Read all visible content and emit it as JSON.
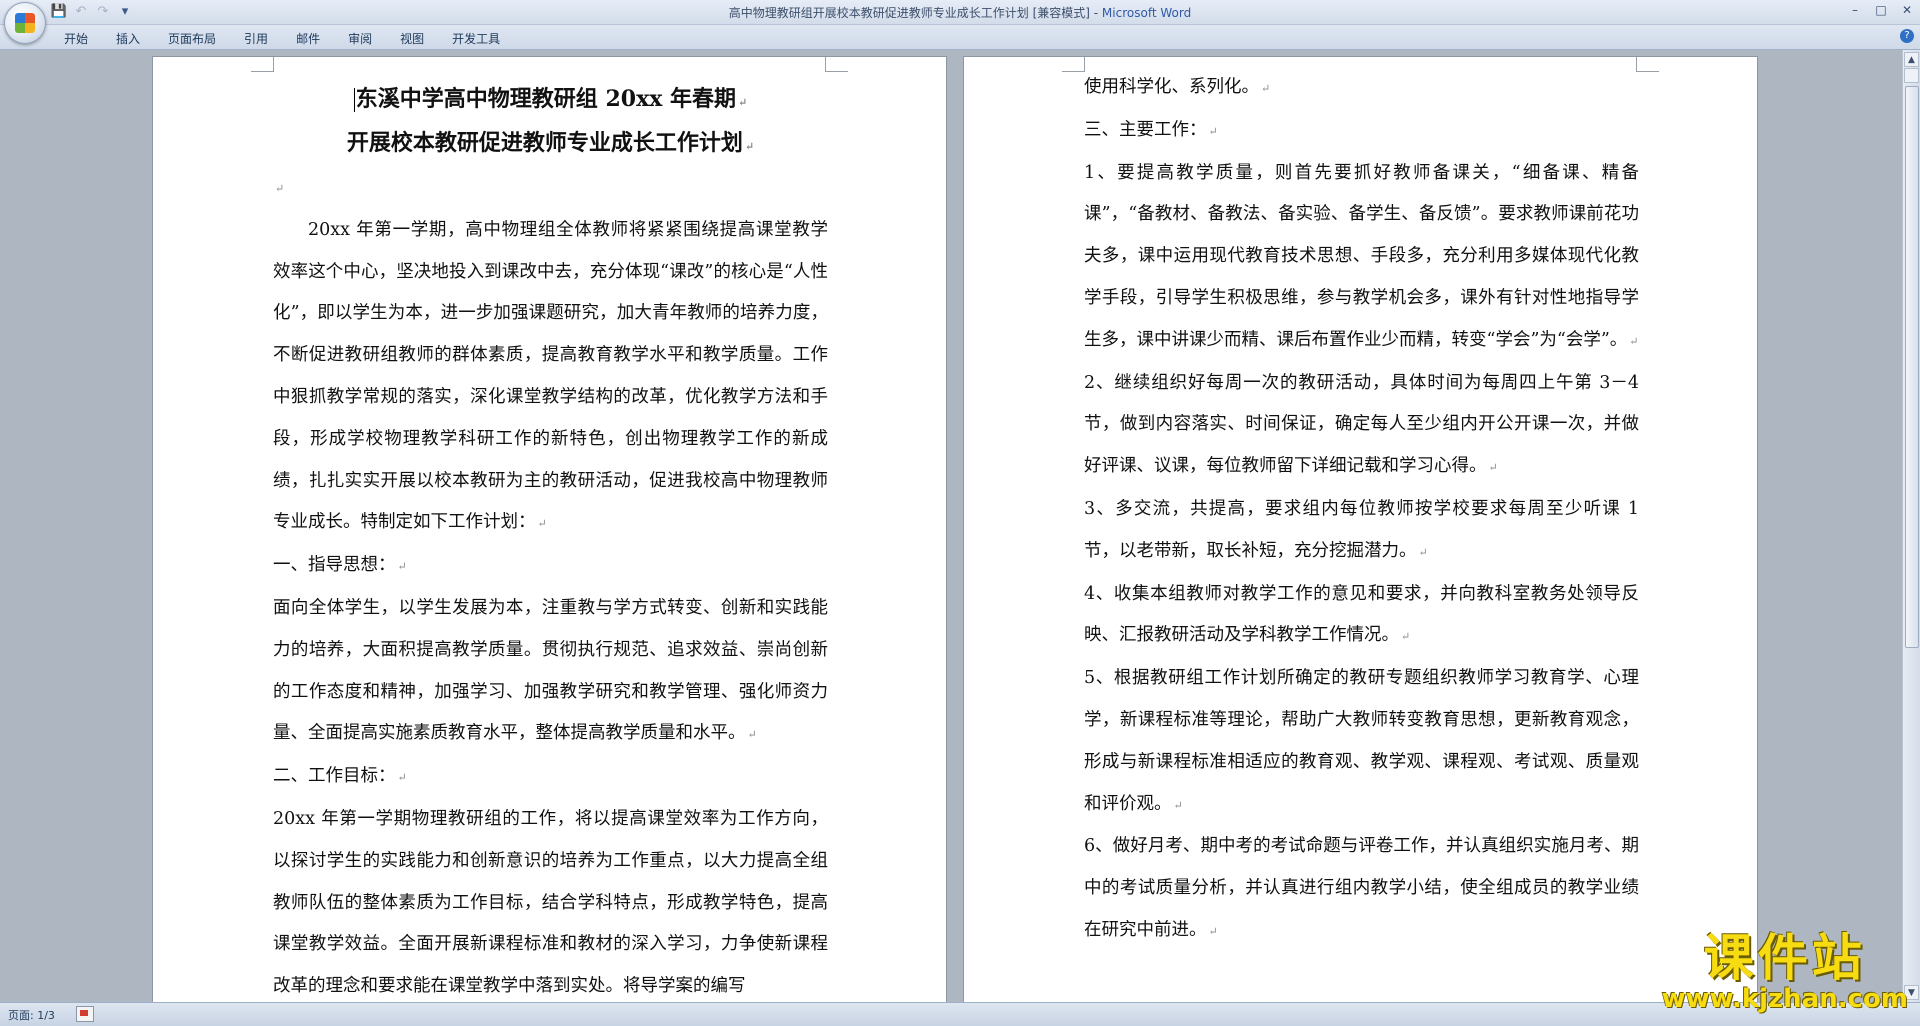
{
  "window": {
    "title": "高中物理教研组开展校本教研促进教师专业成长工作计划 [兼容模式] - ",
    "app_name": "Microsoft Word",
    "minimize": "–",
    "maximize": "□",
    "close": "✕"
  },
  "quick_access": {
    "save": "💾",
    "undo": "↶",
    "redo": "↷",
    "more": "▾"
  },
  "ribbon_tabs": [
    "开始",
    "插入",
    "页面布局",
    "引用",
    "邮件",
    "审阅",
    "视图",
    "开发工具"
  ],
  "help": "?",
  "page_left": {
    "title_line1": "东溪中学高中物理教研组 20xx 年春期",
    "title_line2": "开展校本教研促进教师专业成长工作计划",
    "paragraphs": [
      "20xx 年第一学期，高中物理组全体教师将紧紧围绕提高课堂教学效率这个中心，坚决地投入到课改中去，充分体现“课改”的核心是“人性化”，即以学生为本，进一步加强课题研究，加大青年教师的培养力度，不断促进教研组教师的群体素质，提高教育教学水平和教学质量。工作中狠抓教学常规的落实，深化课堂教学结构的改革，优化教学方法和手段，形成学校物理教学科研工作的新特色，创出物理教学工作的新成绩，扎扎实实开展以校本教研为主的教研活动，促进我校高中物理教师专业成长。特制定如下工作计划：",
      "一、指导思想：",
      "面向全体学生，以学生发展为本，注重教与学方式转变、创新和实践能力的培养，大面积提高教学质量。贯彻执行规范、追求效益、崇尚创新的工作态度和精神，加强学习、加强教学研究和教学管理、强化师资力量、全面提高实施素质教育水平，整体提高教学质量和水平。",
      "二、工作目标：",
      "20xx 年第一学期物理教研组的工作，将以提高课堂效率为工作方向，以探讨学生的实践能力和创新意识的培养为工作重点，以大力提高全组教师队伍的整体素质为工作目标，结合学科特点，形成教学特色，提高课堂教学效益。全面开展新课程标准和教材的深入学习，力争使新课程改革的理念和要求能在课堂教学中落到实处。将导学案的编写"
    ]
  },
  "page_right": {
    "paragraphs": [
      "使用科学化、系列化。",
      "三、主要工作：",
      "1、要提高教学质量，则首先要抓好教师备课关，“细备课、精备课”，“备教材、备教法、备实验、备学生、备反馈”。要求教师课前花功夫多，课中运用现代教育技术思想、手段多，充分利用多媒体现代化教学手段，引导学生积极思维，参与教学机会多，课外有针对性地指导学生多，课中讲课少而精、课后布置作业少而精，转变“学会”为“会学”。",
      "2、继续组织好每周一次的教研活动，具体时间为每周四上午第 3－4 节，做到内容落实、时间保证，确定每人至少组内开公开课一次，并做好评课、议课，每位教师留下详细记载和学习心得。",
      "3、多交流，共提高，要求组内每位教师按学校要求每周至少听课 1 节，以老带新，取长补短，充分挖掘潜力。",
      "4、收集本组教师对教学工作的意见和要求，并向教科室教务处领导反映、汇报教研活动及学科教学工作情况。",
      "5、根据教研组工作计划所确定的教研专题组织教师学习教育学、心理学，新课程标准等理论，帮助广大教师转变教育思想，更新教育观念，形成与新课程标准相适应的教育观、教学观、课程观、考试观、质量观和评价观。",
      "6、做好月考、期中考的考试命题与评卷工作，并认真组织实施月考、期中的考试质量分析，并认真进行组内教学小结，使全组成员的教学业绩在研究中前进。"
    ]
  },
  "paragraph_mark": "↵",
  "statusbar": {
    "page_indicator": "页面: 1/3"
  },
  "watermark": {
    "main": "课件站",
    "url": "www.kjzhan.com"
  },
  "scrollbar": {
    "up": "▲",
    "down": "▼"
  }
}
